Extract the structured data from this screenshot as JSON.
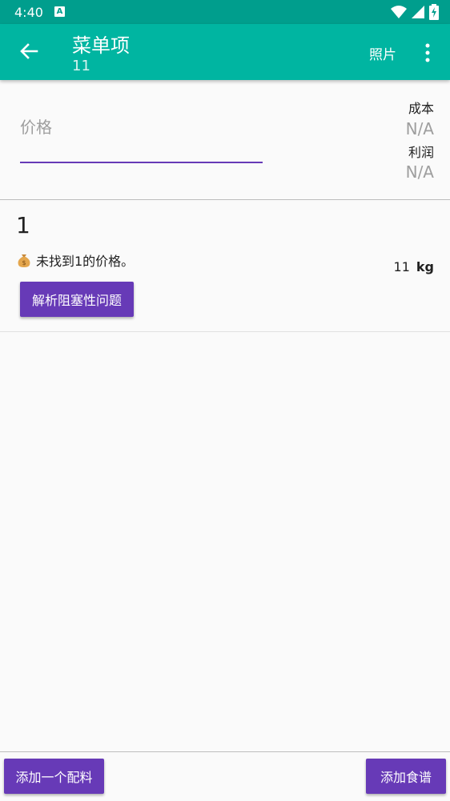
{
  "status_bar": {
    "time": "4:40",
    "notification_icon_letter": "A",
    "icons": [
      "wifi-icon",
      "signal-icon",
      "battery-charging-icon"
    ]
  },
  "app_bar": {
    "title": "菜单项",
    "subtitle": "11",
    "photo_label": "照片",
    "background_color": "#00b5a1"
  },
  "price_section": {
    "price_placeholder": "价格",
    "cost_label": "成本",
    "cost_value": "N/A",
    "profit_label": "利润",
    "profit_value": "N/A"
  },
  "ingredients": [
    {
      "name": "1",
      "warning": "未找到1的价格。",
      "quantity": "11",
      "unit": "kg",
      "resolve_label": "解析阻塞性问题"
    }
  ],
  "bottom_bar": {
    "add_ingredient_label": "添加一个配料",
    "add_recipe_label": "添加食谱"
  },
  "colors": {
    "accent": "#673ab7",
    "status_bar": "#009e8d"
  }
}
